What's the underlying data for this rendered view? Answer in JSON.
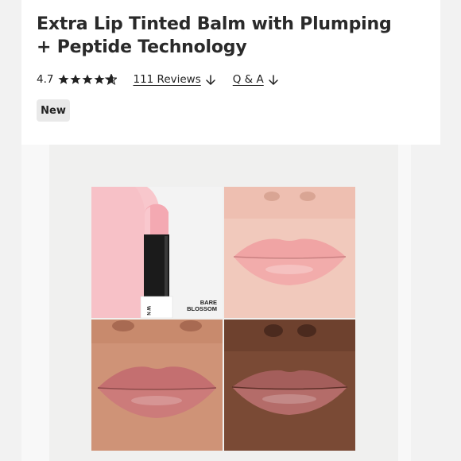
{
  "product": {
    "title": "Extra Lip Tinted Balm with Plumping + Peptide Technology",
    "rating": "4.7",
    "rating_stars": 4.7,
    "reviews_link": "111 Reviews",
    "qa_link": "Q & A",
    "badge": "New"
  },
  "image": {
    "shade_label_line1": "BARE",
    "shade_label_line2": "BLOSSOM",
    "brand_mark": "W N",
    "panels": [
      "product-shot",
      "lips-light-skin",
      "lips-medium-skin",
      "lips-deep-skin"
    ]
  },
  "colors": {
    "background": "#f2f2f2",
    "card": "#ffffff",
    "badge_bg": "#e9e9e9",
    "text": "#222222",
    "balm_pink": "#f4b4ba"
  },
  "icons": [
    "star-icon",
    "arrow-down-icon"
  ]
}
